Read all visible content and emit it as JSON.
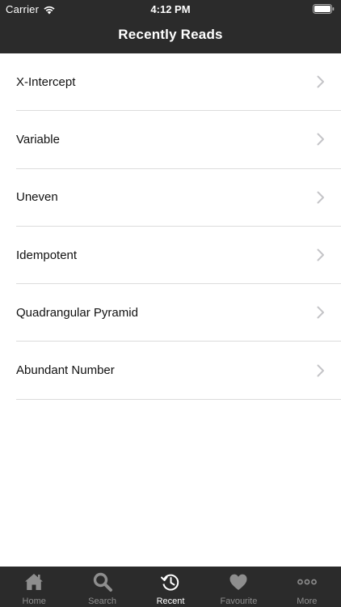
{
  "status_bar": {
    "carrier": "Carrier",
    "time": "4:12 PM"
  },
  "header": {
    "title": "Recently Reads"
  },
  "list": {
    "items": [
      {
        "label": "X-Intercept"
      },
      {
        "label": "Variable"
      },
      {
        "label": "Uneven"
      },
      {
        "label": "Idempotent"
      },
      {
        "label": "Quadrangular Pyramid"
      },
      {
        "label": "Abundant Number"
      }
    ]
  },
  "tabbar": {
    "tabs": [
      {
        "label": "Home",
        "icon": "home-icon"
      },
      {
        "label": "Search",
        "icon": "search-icon"
      },
      {
        "label": "Recent",
        "icon": "history-icon",
        "active": true
      },
      {
        "label": "Favourite",
        "icon": "heart-icon"
      },
      {
        "label": "More",
        "icon": "more-icon"
      }
    ]
  },
  "colors": {
    "bar_bg": "#2b2b2b",
    "active_tab": "#ffffff",
    "inactive_tab": "#8e8e8e",
    "separator": "#dcdcdc"
  }
}
